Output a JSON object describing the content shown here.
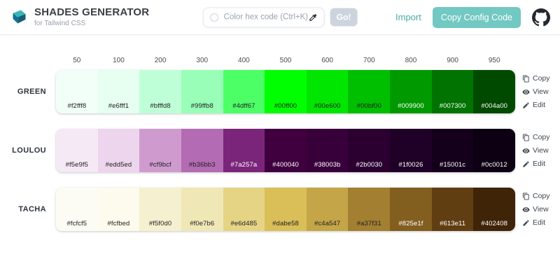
{
  "header": {
    "title": "SHADES GENERATOR",
    "subtitle": "for Tailwind CSS",
    "search": {
      "value": "",
      "placeholder": "Color hex code (Ctrl+K)"
    },
    "go_label": "Go!",
    "import_label": "Import",
    "copy_config_label": "Copy Config Code"
  },
  "columns": [
    "50",
    "100",
    "200",
    "300",
    "400",
    "500",
    "600",
    "700",
    "800",
    "900",
    "950"
  ],
  "palettes": [
    {
      "name": "GREEN",
      "shades": [
        "#f2fff8",
        "#e6fff1",
        "#bfffd8",
        "#99ffb8",
        "#4dff67",
        "#00ff00",
        "#00e600",
        "#00bf00",
        "#009900",
        "#007300",
        "#004a00"
      ]
    },
    {
      "name": "LOULOU",
      "shades": [
        "#f5e9f5",
        "#edd5ed",
        "#cf9bcf",
        "#b36bb3",
        "#7a257a",
        "#400040",
        "#38003b",
        "#2b0030",
        "#1f0026",
        "#15001c",
        "#0c0012"
      ]
    },
    {
      "name": "TACHA",
      "shades": [
        "#fcfcf5",
        "#fcfbed",
        "#f5f0d0",
        "#f0e7b6",
        "#e6d485",
        "#dabe58",
        "#c4a547",
        "#a37f31",
        "#825e1f",
        "#613e11",
        "#402408"
      ]
    }
  ],
  "row_actions": [
    {
      "label": "Copy",
      "icon": "copy-icon"
    },
    {
      "label": "View",
      "icon": "eye-icon"
    },
    {
      "label": "Edit",
      "icon": "pencil-icon"
    }
  ],
  "colors": {
    "accent_teal": "#72c8c2",
    "link_teal": "#4aa9a5",
    "go_disabled": "#cdd4de",
    "swatch_dark_text": "#222222",
    "swatch_light_text": "#ffffff"
  }
}
